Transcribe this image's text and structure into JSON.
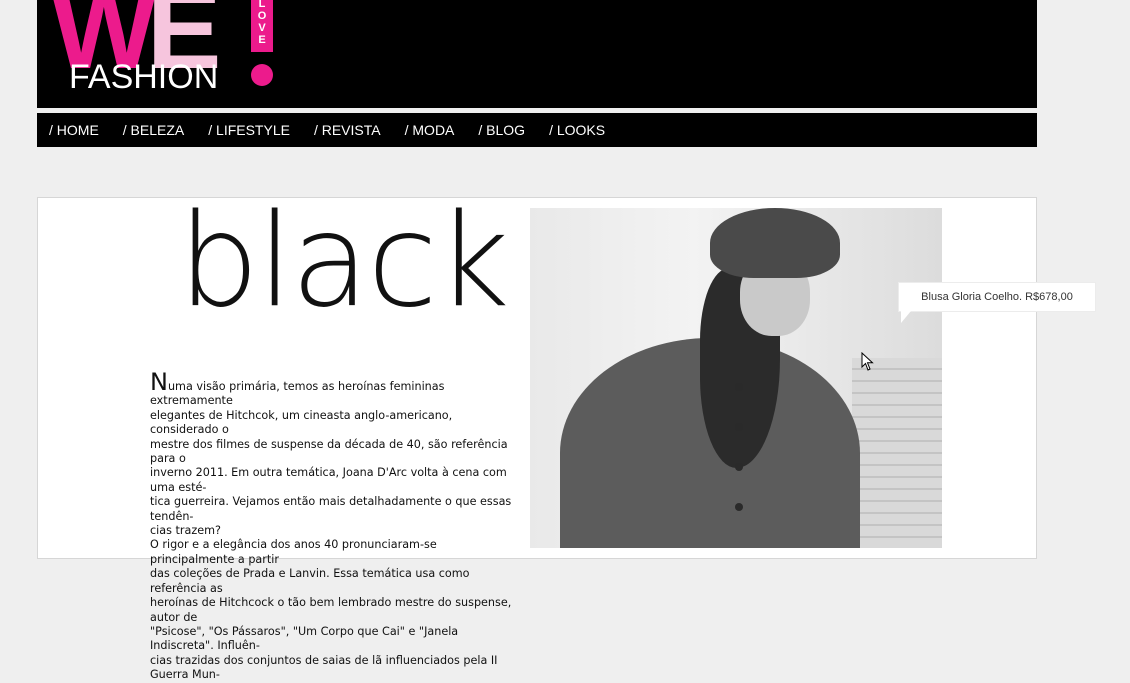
{
  "logo": {
    "we": "WE",
    "love": "LOVE",
    "fashion": "FASHION"
  },
  "nav": {
    "items": [
      "/ HOME",
      "/ BELEZA",
      "/ LIFESTYLE",
      "/ REVISTA",
      "/ MODA",
      "/ BLOG",
      "/ LOOKS"
    ]
  },
  "article": {
    "title": "black",
    "dropcap": "N",
    "lines": [
      "uma visão primária, temos as heroínas femininas extremamente",
      "elegantes de Hitchcok, um cineasta anglo-americano, considerado o",
      "mestre dos filmes de suspense da década de 40, são referência para o",
      "inverno 2011. Em outra temática, Joana D'Arc volta à cena com uma esté-",
      "tica guerreira. Vejamos então mais detalhadamente o que essas tendên-",
      "cias trazem?",
      "O rigor e a elegância dos anos 40 pronunciaram-se principalmente a partir",
      "das coleções de Prada e Lanvin. Essa temática usa como referência as",
      "heroínas de Hitchcock o tão bem lembrado mestre do suspense, autor de",
      "\"Psicose\", \"Os Pássaros\", \"Um Corpo que Cai\" e \"Janela Indiscreta\". Influên-",
      "cias trazidas dos conjuntos de saias de lã influenciados pela II Guerra Mun-"
    ]
  },
  "tooltip": {
    "text": "Blusa Gloria Coelho. R$678,00"
  }
}
